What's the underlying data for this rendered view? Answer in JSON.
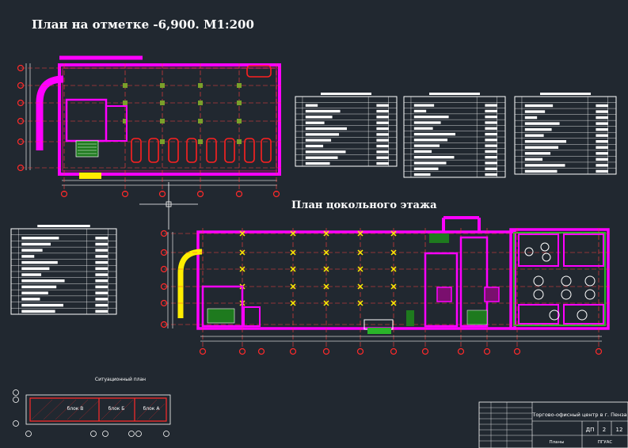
{
  "titles": {
    "upper_plan": "План на отметке -6,900. М1:200",
    "lower_plan": "План цокольного этажа"
  },
  "site_plan": {
    "caption": "Ситуационный план",
    "blocks": [
      "блок В",
      "блок Б",
      "блок А"
    ]
  },
  "title_block": {
    "project": "Торгово-офисный центр в г. Пенза",
    "stage": "ДП",
    "sheet": "2",
    "sheets": "12",
    "sheet_name": "Планы",
    "org": "ПГУАС"
  },
  "colors": {
    "background": "#212830",
    "walls": "#ff00ff",
    "columns": "#7aa02a",
    "gridlines": "#ff3030",
    "axes_markers": "#ff2a2a",
    "drawing_lines": "#ffffff",
    "yellow": "#ffee00",
    "green": "#2ab52a",
    "cars": "#ff2020"
  }
}
